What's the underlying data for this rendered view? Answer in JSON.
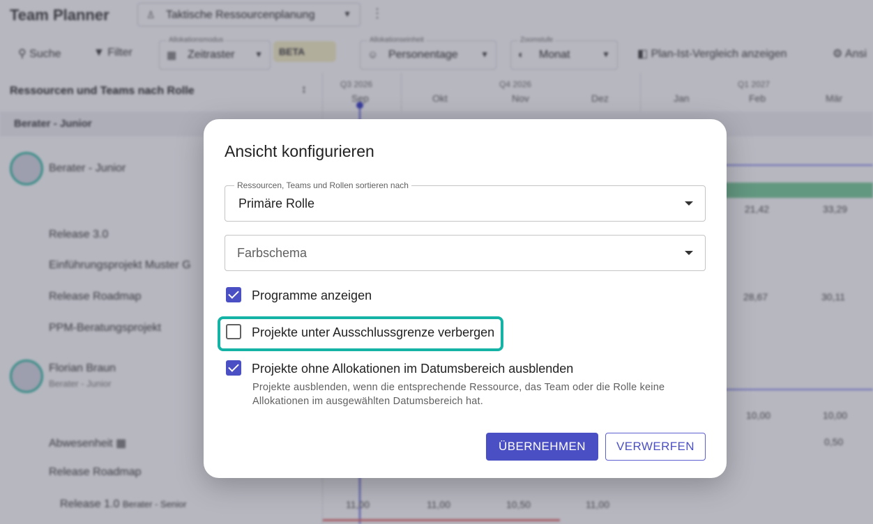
{
  "app": {
    "title": "Team Planner",
    "plan_name": "Taktische Ressourcenplanung",
    "toolbar": {
      "search_label": "Suche",
      "filter_label": "Filter",
      "allocation_mode_label": "Allokationsmodus",
      "allocation_mode_value": "Zeitraster",
      "beta_label": "BETA",
      "allocation_unit_label": "Allokationseinheit",
      "allocation_unit_value": "Personentage",
      "zoom_label": "Zoomstufe",
      "zoom_value": "Monat",
      "compare_label": "Plan-Ist-Vergleich anzeigen",
      "more_label": "Ansi"
    },
    "left_panel": {
      "header": "Ressourcen und Teams nach Rolle",
      "group": "Berater - Junior",
      "rows": [
        "Berater - Junior",
        "Release 3.0",
        "Einführungsprojekt Muster G",
        "Release Roadmap",
        "PPM-Beratungsprojekt",
        "Florian Braun",
        "Berater - Junior",
        "Abwesenheit",
        "Release Roadmap",
        "Release 1.0",
        "Berater - Senior"
      ]
    },
    "timeline": {
      "quarters": [
        "Q3 2026",
        "Q4 2026",
        "Q1 2027"
      ],
      "months": [
        "Sep",
        "Okt",
        "Nov",
        "Dez",
        "Jan",
        "Feb",
        "Mär"
      ],
      "values_a": [
        "21,42",
        "33,29"
      ],
      "values_b": [
        "28,67",
        "30,11"
      ],
      "values_c": [
        "10,00",
        "10,00"
      ],
      "values_d": [
        "0,50"
      ],
      "values_e": [
        "11,00",
        "11,00",
        "10,50",
        "11,00"
      ]
    },
    "colors": {
      "primary": "#4b4fc4",
      "focus_ring": "#14b3a6",
      "allocation_bar": "#7fcf9e"
    }
  },
  "dialog": {
    "title": "Ansicht konfigurieren",
    "sort_field": {
      "label": "Ressourcen, Teams und Rollen sortieren nach",
      "value": "Primäre Rolle"
    },
    "color_field": {
      "placeholder": "Farbschema"
    },
    "checkboxes": [
      {
        "label": "Programme anzeigen",
        "checked": true
      },
      {
        "label": "Projekte unter Ausschlussgrenze verbergen",
        "checked": false
      },
      {
        "label": "Projekte ohne Allokationen im Datumsbereich ausblenden",
        "checked": true
      }
    ],
    "help_text": "Projekte ausblenden, wenn die entsprechende Ressource, das Team oder die Rolle keine Allokationen im ausgewählten Datumsbereich hat.",
    "apply_label": "ÜBERNEHMEN",
    "discard_label": "VERWERFEN"
  }
}
